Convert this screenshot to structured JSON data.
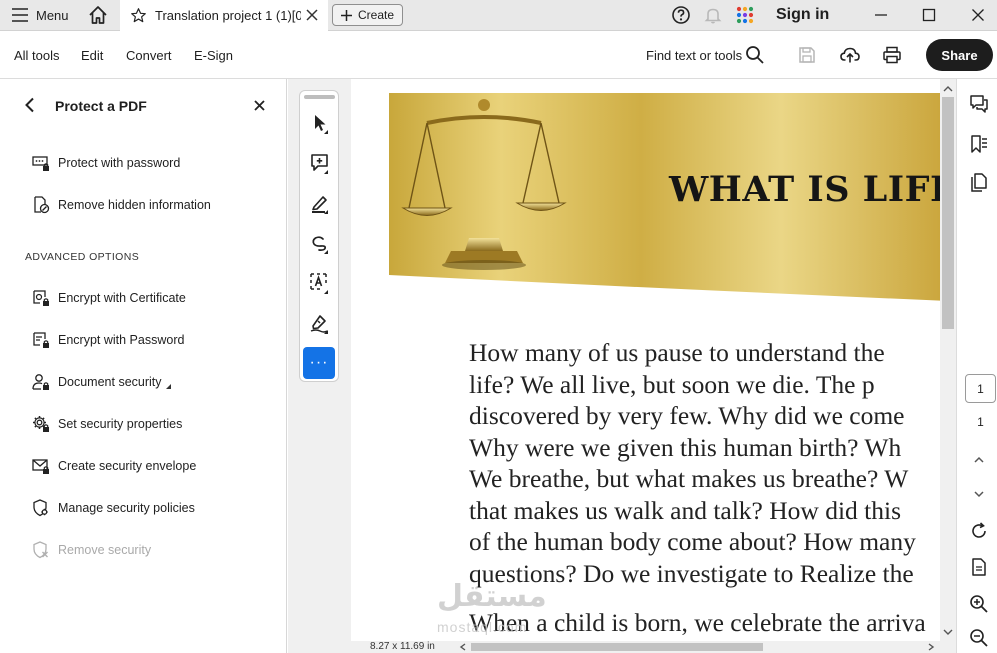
{
  "titlebar": {
    "menu_label": "Menu",
    "tab_title": "Translation project 1 (1)[0...",
    "create_label": "Create",
    "sign_in_label": "Sign in"
  },
  "toolbar": {
    "menus": [
      "All tools",
      "Edit",
      "Convert",
      "E-Sign"
    ],
    "find_label": "Find text or tools",
    "share_label": "Share"
  },
  "left_panel": {
    "title": "Protect a PDF",
    "items": [
      {
        "label": "Protect with password",
        "icon": "password-field-icon"
      },
      {
        "label": "Remove hidden information",
        "icon": "remove-hidden-icon"
      }
    ],
    "advanced_heading": "ADVANCED OPTIONS",
    "advanced_items": [
      {
        "label": "Encrypt with Certificate",
        "icon": "certificate-lock-icon"
      },
      {
        "label": "Encrypt with Password",
        "icon": "password-lock-icon"
      },
      {
        "label": "Document security",
        "icon": "user-lock-icon"
      },
      {
        "label": "Set security properties",
        "icon": "gear-lock-icon"
      },
      {
        "label": "Create security envelope",
        "icon": "envelope-lock-icon"
      },
      {
        "label": "Manage security policies",
        "icon": "shield-gear-icon"
      },
      {
        "label": "Remove security",
        "icon": "shield-remove-icon",
        "disabled": true
      }
    ]
  },
  "tool_strip": {
    "more_label": "···"
  },
  "document": {
    "banner_title": "WHAT IS LIFE?",
    "lines": [
      "How many of us pause to understand the",
      "life? We all live, but soon we die. The p",
      "discovered by very few. Why did we come",
      "Why were we given this human birth? Wh",
      "We breathe, but what makes us breathe? W",
      "that makes us walk and talk? How did this",
      "of the human body come about? How many",
      "questions? Do we investigate to Realize the",
      "When a child is born, we celebrate the arriva"
    ],
    "watermark_ar": "مستقل",
    "watermark_en": "mostaql.com",
    "page_size": "8.27 x 11.69 in"
  },
  "right_rail": {
    "current_page": "1",
    "total_pages": "1"
  },
  "colors": {
    "accent": "#1473e6",
    "share_bg": "#1d1d1d",
    "banner_gold": "#d9b94a"
  }
}
